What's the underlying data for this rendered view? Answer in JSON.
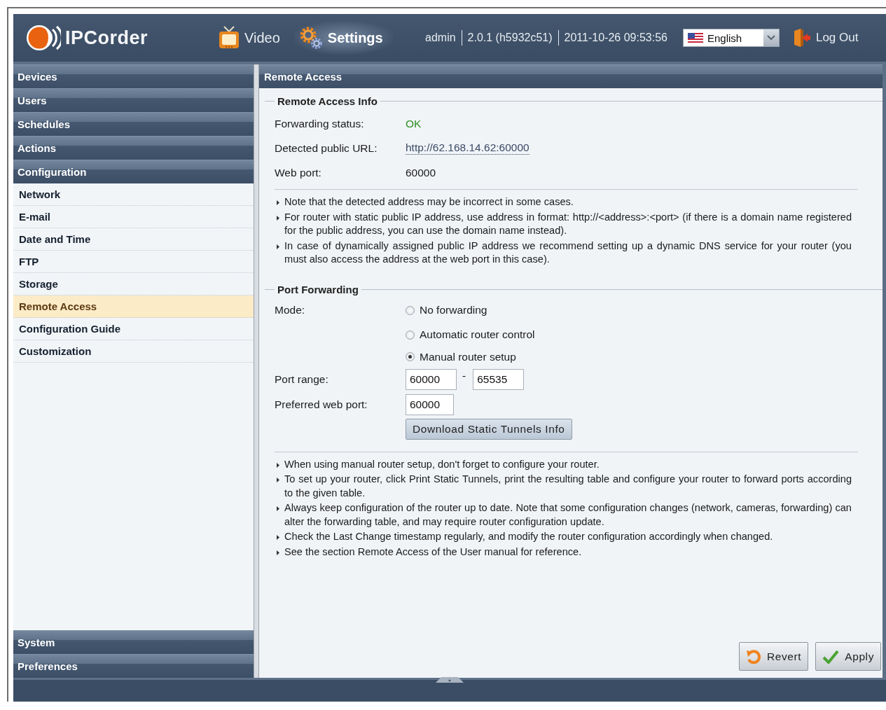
{
  "header": {
    "app_name": "IPCorder",
    "nav": [
      {
        "label": "Video",
        "selected": false
      },
      {
        "label": "Settings",
        "selected": true
      }
    ],
    "user": "admin",
    "version": "2.0.1 (h5932c51)",
    "datetime": "2011-10-26 09:53:56",
    "language": "English",
    "logout": "Log Out"
  },
  "sidebar": {
    "sections": [
      {
        "label": "Devices"
      },
      {
        "label": "Users"
      },
      {
        "label": "Schedules"
      },
      {
        "label": "Actions"
      },
      {
        "label": "Configuration",
        "items": [
          {
            "label": "Network",
            "selected": false
          },
          {
            "label": "E-mail",
            "selected": false
          },
          {
            "label": "Date and Time",
            "selected": false
          },
          {
            "label": "FTP",
            "selected": false
          },
          {
            "label": "Storage",
            "selected": false
          },
          {
            "label": "Remote Access",
            "selected": true
          },
          {
            "label": "Configuration Guide",
            "selected": false
          },
          {
            "label": "Customization",
            "selected": false
          }
        ]
      },
      {
        "label": "System"
      },
      {
        "label": "Preferences"
      }
    ]
  },
  "panel": {
    "title": "Remote Access",
    "info": {
      "legend": "Remote Access Info",
      "fields": [
        {
          "label": "Forwarding status:",
          "value": "OK",
          "kind": "status"
        },
        {
          "label": "Detected public URL:",
          "value": "http://62.168.14.62:60000",
          "kind": "link"
        },
        {
          "label": "Web port:",
          "value": "60000",
          "kind": "text"
        }
      ],
      "notes": [
        "Note that the detected address may be incorrect in some cases.",
        "For router with static public IP address, use address in format: http://<address>:<port> (if there is a domain name registered for the public address, you can use the domain name instead).",
        "In case of dynamically assigned public IP address we recommend setting up a dynamic DNS service for your router (you must also access the address at the web port in this case)."
      ]
    },
    "forwarding": {
      "legend": "Port Forwarding",
      "mode_label": "Mode:",
      "modes": [
        {
          "label": "No forwarding",
          "selected": false
        },
        {
          "label": "Automatic router control",
          "selected": false
        },
        {
          "label": "Manual router setup",
          "selected": true
        }
      ],
      "port_range_label": "Port range:",
      "port_from": "60000",
      "range_separator": "-",
      "port_to": "65535",
      "preferred_label": "Preferred web port:",
      "preferred_port": "60000",
      "download_button": "Download Static Tunnels Info",
      "notes": [
        "When using manual router setup, don't forget to configure your router.",
        "To set up your router, click Print Static Tunnels, print the resulting table and configure your router to forward ports according to the given table.",
        "Always keep configuration of the router up to date. Note that some configuration changes (network, cameras, forwarding) can alter the forwarding table, and may require router configuration update.",
        "Check the Last Change timestamp regularly, and modify the router configuration accordingly when changed.",
        "See the section Remote Access of the User manual for reference."
      ]
    },
    "buttons": [
      {
        "label": "Revert",
        "kind": "revert"
      },
      {
        "label": "Apply",
        "kind": "apply"
      }
    ]
  }
}
